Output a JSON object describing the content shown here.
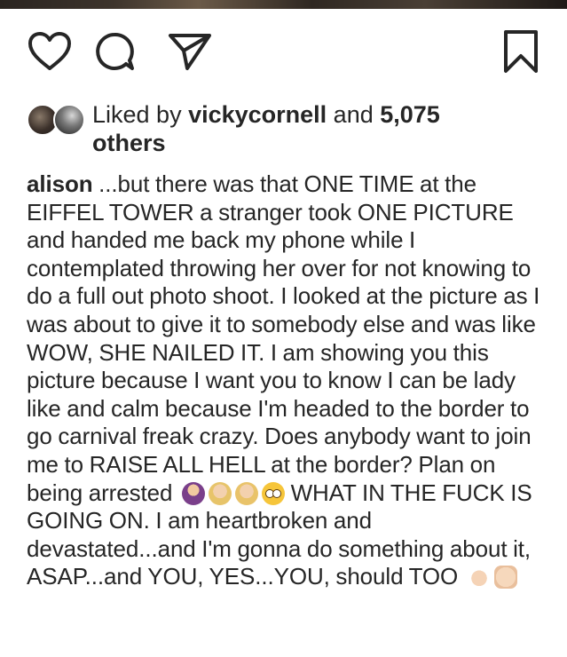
{
  "post": {
    "actions": [
      {
        "name": "like-button",
        "icon": "heart-icon"
      },
      {
        "name": "comment-button",
        "icon": "comment-bubble-icon"
      },
      {
        "name": "share-button",
        "icon": "paper-plane-icon"
      },
      {
        "name": "save-button",
        "icon": "bookmark-icon"
      }
    ],
    "likes": {
      "prefix": "Liked by ",
      "user": "vickycornell",
      "middle": " and ",
      "count": "5,075",
      "suffix": "others"
    },
    "caption": {
      "username": "alison",
      "text_main": " ...but there was that ONE TIME at the EIFFEL TOWER a stranger took ONE PICTURE and handed me back my phone while I contemplated throwing her over for not knowing to do a full out photo shoot. I looked at the picture as I was about to give it to somebody else and was like WOW, SHE NAILED IT. I am showing you this picture because I want you to know I can be lady like and calm because I'm headed to the border to go carnival freak crazy. Does anybody want to join me to RAISE ALL HELL at the border? Plan on being arrested",
      "text_after_emojis": " WHAT IN THE FUCK IS GOING ON. I am heartbroken and devastated...and I'm gonna do something about it, ASAP...and YOU, YES...YOU, should TOO",
      "emojis_1": [
        "woman-shrugging-emoji",
        "woman-facepalming-emoji",
        "woman-facepalming-emoji",
        "flushed-face-emoji"
      ],
      "emojis_2": [
        "folded-hands-emoji",
        "oncoming-fist-emoji"
      ]
    }
  },
  "colors": {
    "text": "#262626",
    "background": "#ffffff"
  }
}
